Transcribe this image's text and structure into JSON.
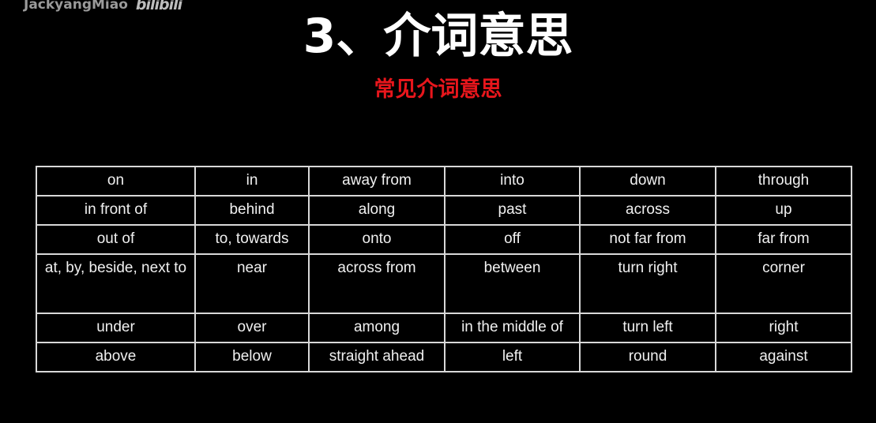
{
  "watermark": {
    "author": "JackyangMiao",
    "logo": "bilibili"
  },
  "title": "3、介词意思",
  "subtitle": "常见介词意思",
  "table": {
    "rows": [
      [
        "on",
        "in",
        "away from",
        "into",
        "down",
        "through"
      ],
      [
        "in front of",
        "behind",
        "along",
        "past",
        "across",
        "up"
      ],
      [
        "out of",
        "to, towards",
        "onto",
        "off",
        "not far from",
        "far from"
      ],
      [
        "at, by, beside, next to",
        "near",
        "across from",
        "between",
        "turn right",
        "corner"
      ],
      [
        "under",
        "over",
        "among",
        "in the middle of",
        "turn left",
        "right"
      ],
      [
        "above",
        "below",
        "straight ahead",
        "left",
        "round",
        "against"
      ]
    ]
  }
}
